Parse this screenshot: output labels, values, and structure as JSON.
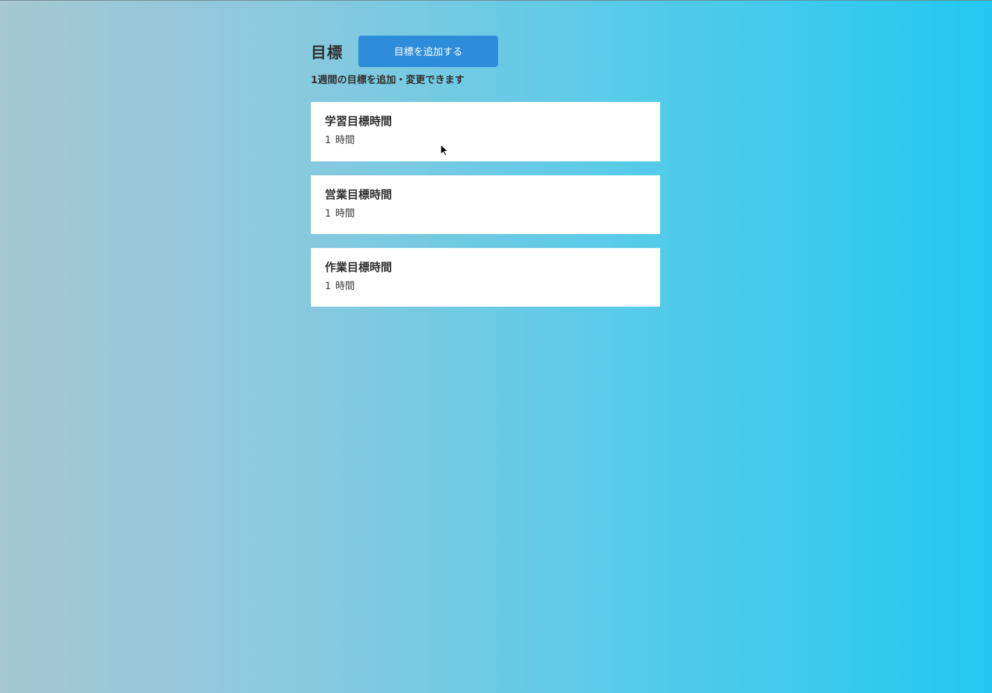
{
  "header": {
    "title": "目標",
    "add_button_label": "目標を追加する",
    "subtitle": "1週間の目標を追加・変更できます"
  },
  "goals": [
    {
      "name": "学習目標時間",
      "value": "1",
      "unit": "時間"
    },
    {
      "name": "営業目標時間",
      "value": "1",
      "unit": "時間"
    },
    {
      "name": "作業目標時間",
      "value": "1",
      "unit": "時間"
    }
  ],
  "colors": {
    "accent": "#2e8ddb",
    "card_background": "#ffffff",
    "text": "#2f2f2f"
  },
  "icons": {
    "cursor": "mouse-pointer-icon"
  }
}
